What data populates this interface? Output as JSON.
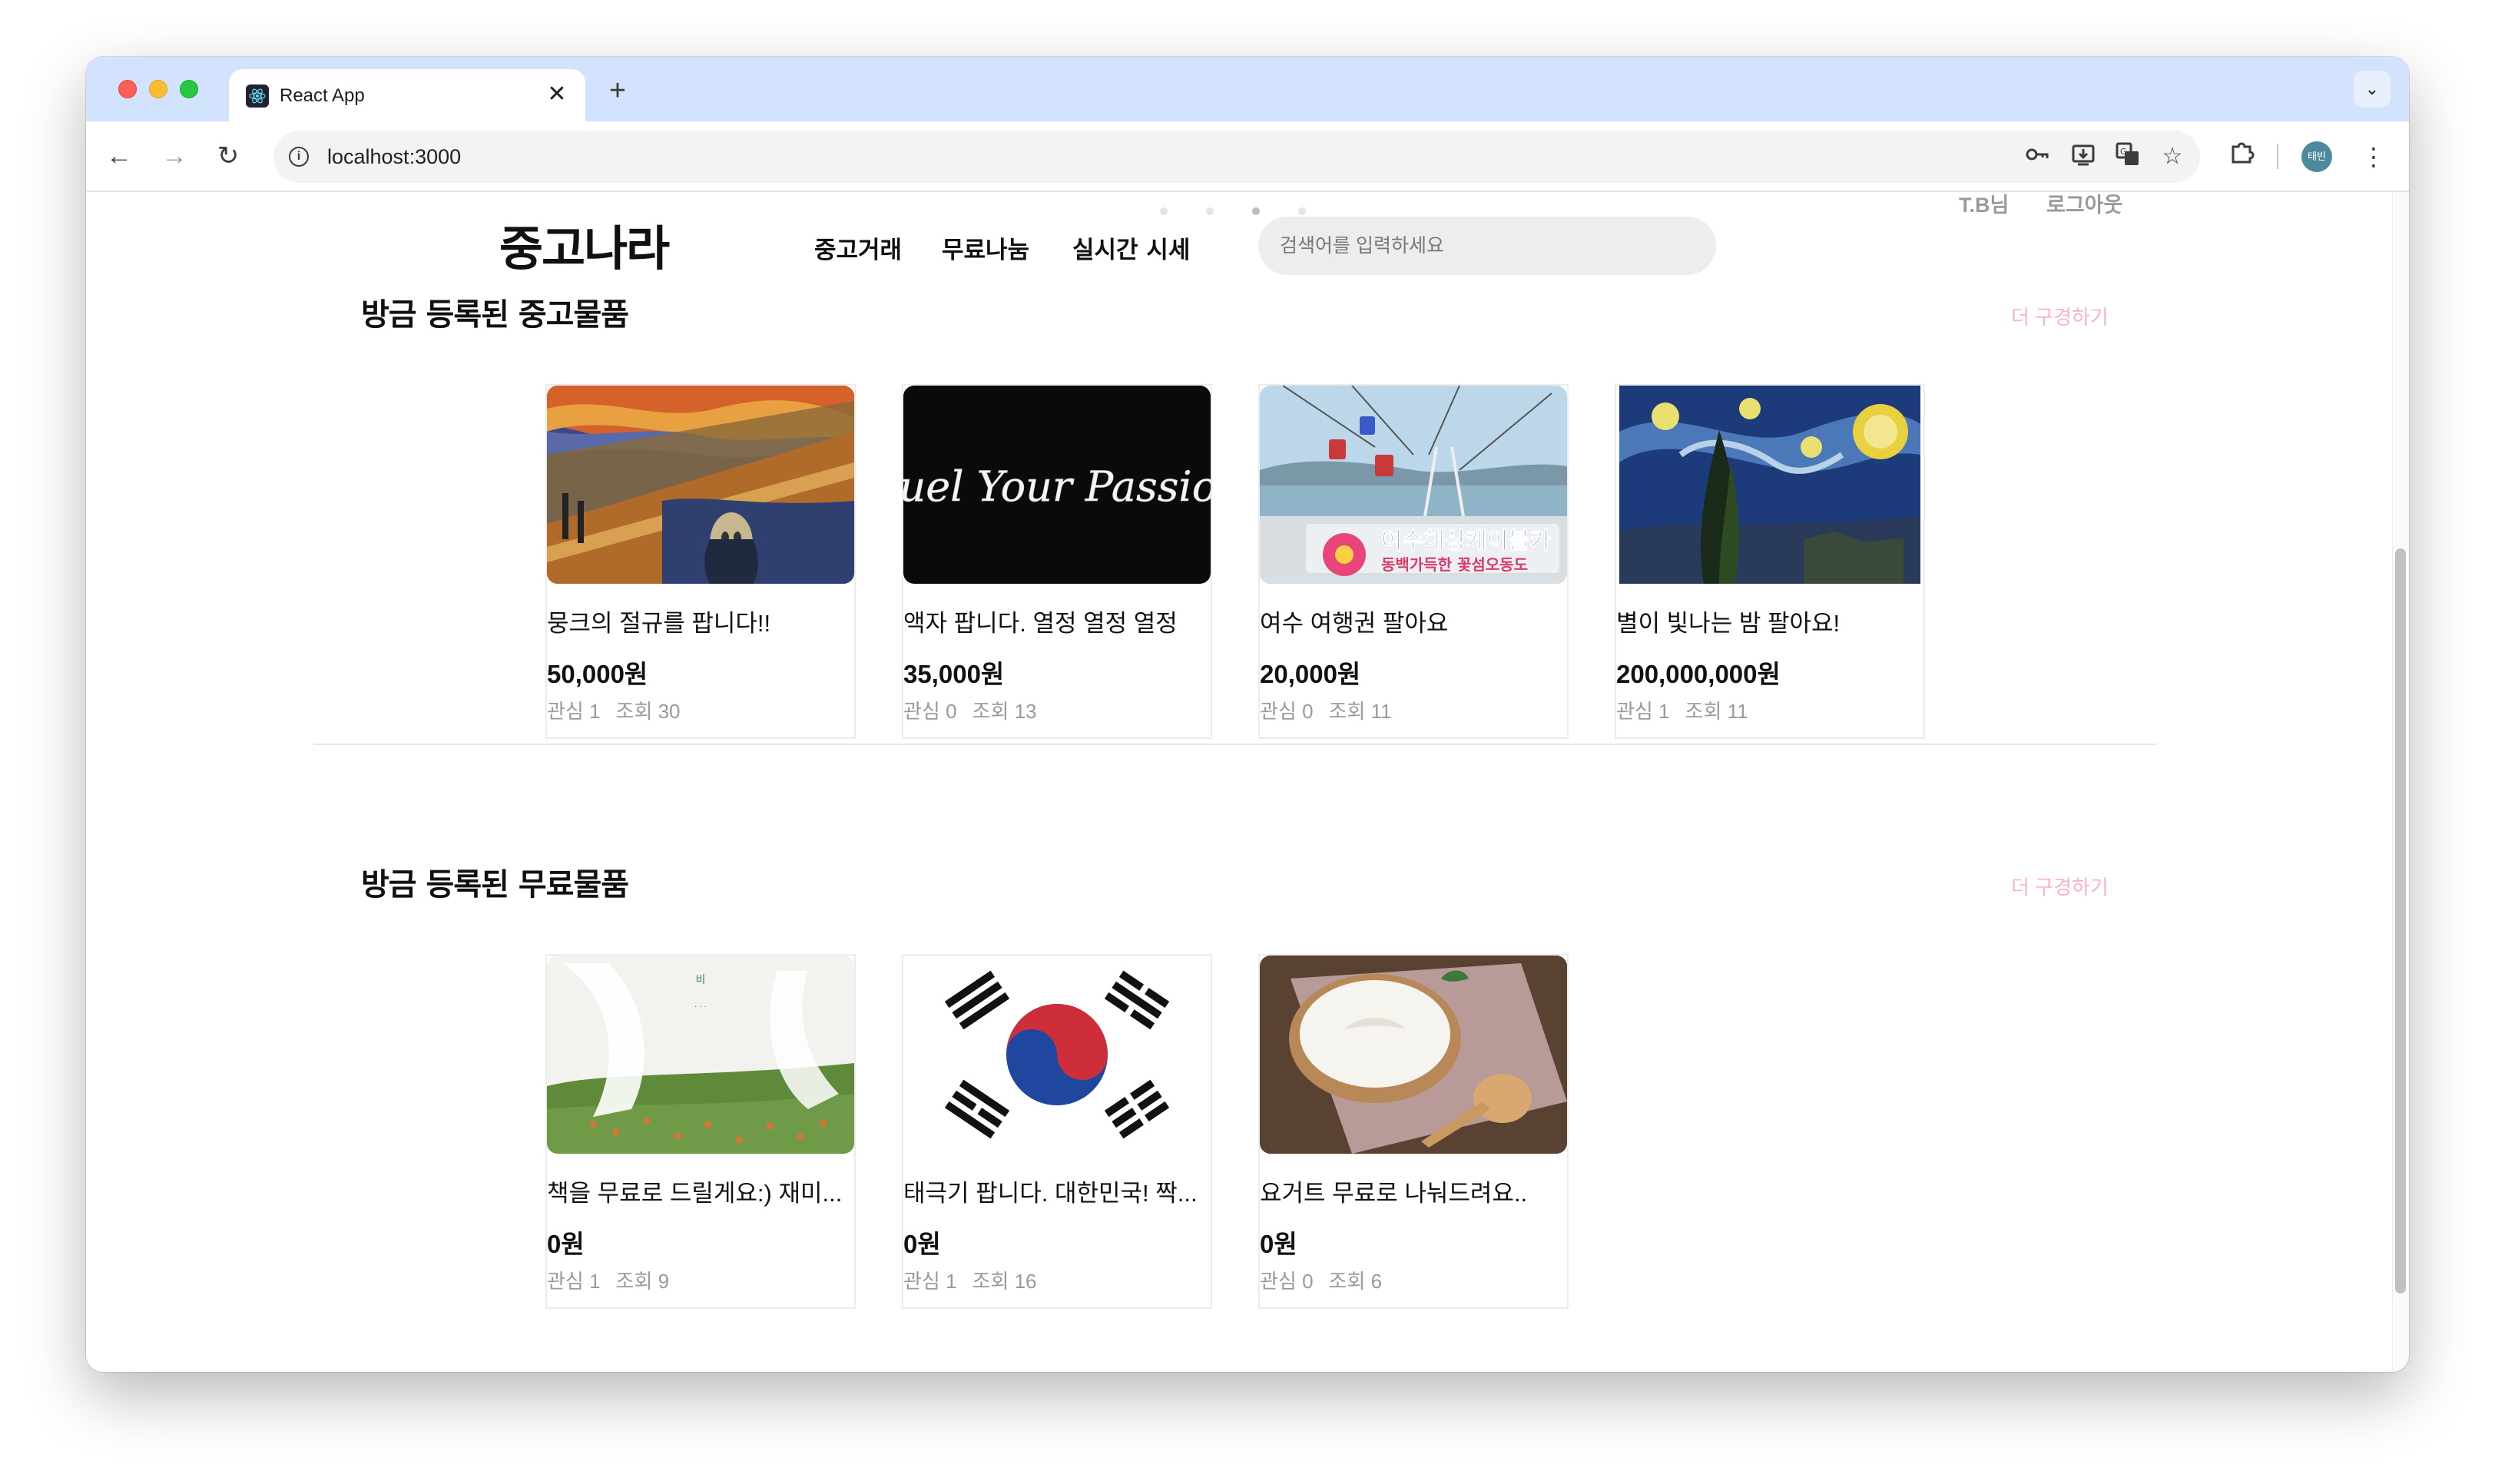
{
  "browser": {
    "tab_title": "React App",
    "tab_close": "✕",
    "new_tab": "+",
    "url": "localhost:3000"
  },
  "header": {
    "logo": "중고나라",
    "nav": [
      "중고거래",
      "무료나눔",
      "실시간 시세"
    ],
    "search_placeholder": "검색어를 입력하세요",
    "user_name": "T.B님",
    "logout_label": "로그아웃",
    "profile_initials": "태빈"
  },
  "sections": [
    {
      "title": "방금 등록된 중고물품",
      "more_label": "더 구경하기",
      "items": [
        {
          "title": "뭉크의 절규를 팝니다!!",
          "price": "50,000원",
          "likes": "관심 1",
          "views": "조회 30"
        },
        {
          "title": "액자 팝니다. 열정 열정 열정",
          "price": "35,000원",
          "likes": "관심 0",
          "views": "조회 13"
        },
        {
          "title": "여수 여행권 팔아요",
          "price": "20,000원",
          "likes": "관심 0",
          "views": "조회 11"
        },
        {
          "title": "별이 빛나는 밤 팔아요!",
          "price": "200,000,000원",
          "likes": "관심 1",
          "views": "조회 11"
        }
      ]
    },
    {
      "title": "방금 등록된 무료물품",
      "more_label": "더 구경하기",
      "items": [
        {
          "title": "책을 무료로 드릴게요:) 재미...",
          "price": "0원",
          "likes": "관심 1",
          "views": "조회 9"
        },
        {
          "title": "태극기 팝니다. 대한민국! 짝...",
          "price": "0원",
          "likes": "관심 1",
          "views": "조회 16"
        },
        {
          "title": "요거트 무료로 나눠드려요..",
          "price": "0원",
          "likes": "관심 0",
          "views": "조회 6"
        }
      ]
    }
  ],
  "images": {
    "neon_text": "Fuel Your Passion",
    "cable_car_title": "여수해상케이블카",
    "cable_car_sub": "동백가득한 꽃섬오동도"
  },
  "colors": {
    "tab_strip": "#d3e3fd",
    "more_link": "#f7b5c2",
    "meta_text": "#9a9a9a"
  }
}
